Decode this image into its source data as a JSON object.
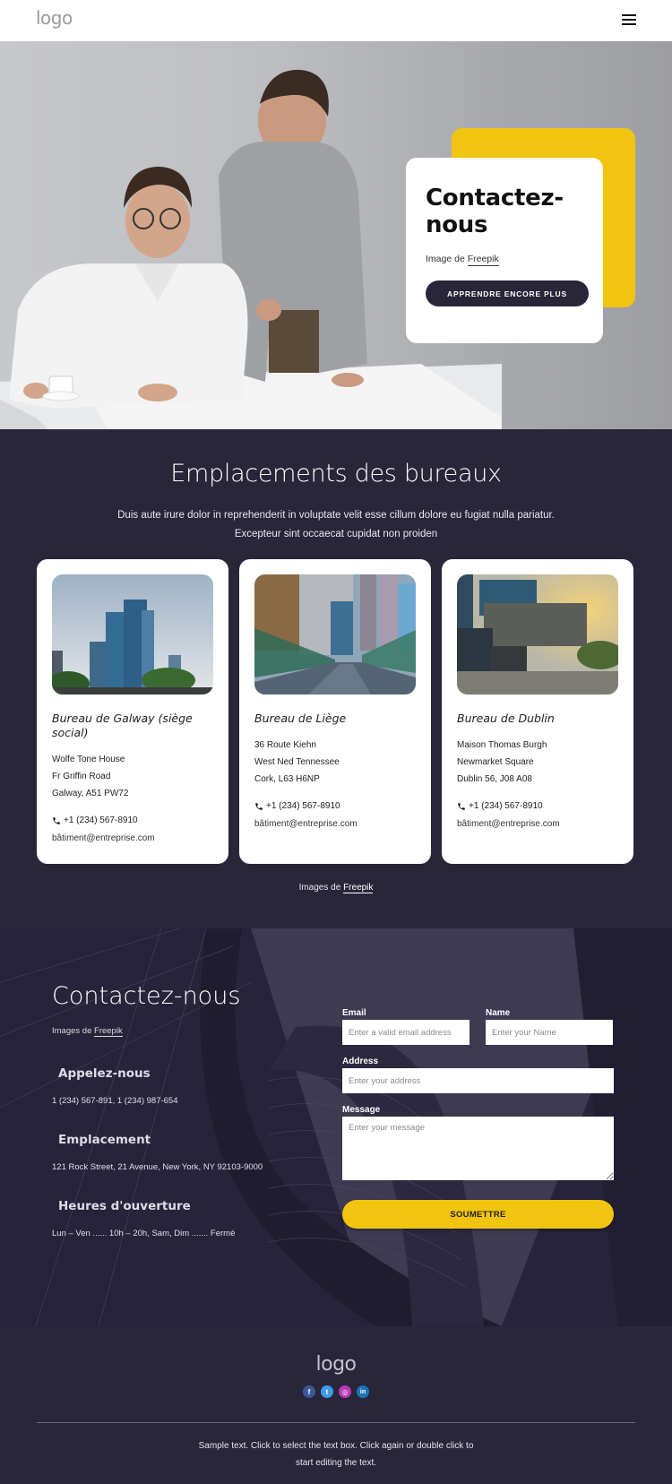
{
  "header": {
    "logo": "logo",
    "menu_icon": "hamburger-menu-icon"
  },
  "hero": {
    "title": "Contactez-nous",
    "credit_prefix": "Image de",
    "credit_link": "Freepik",
    "button_label": "APPRENDRE ENCORE PLUS",
    "accent_color": "#f1c40f",
    "button_color": "#292639"
  },
  "offices": {
    "title": "Emplacements des bureaux",
    "lead_line1": "Duis aute irure dolor in reprehenderit in voluptate velit esse cillum dolore eu fugiat nulla pariatur.",
    "lead_line2": "Excepteur sint occaecat cupidat non proiden",
    "cards": [
      {
        "name": "Bureau de Galway (siège social)",
        "address": [
          "Wolfe Tone House",
          "Fr Griffin Road",
          "Galway, A51 PW72"
        ],
        "phone": "+1 (234) 567-8910",
        "email": "bâtiment@entreprise.com"
      },
      {
        "name": "Bureau de Liège",
        "address": [
          "36 Route Kiehn",
          "West Ned Tennessee",
          "Cork, L63 H6NP"
        ],
        "phone": "+1 (234) 567-8910",
        "email": "bâtiment@entreprise.com"
      },
      {
        "name": "Bureau de Dublin",
        "address": [
          "Maison Thomas Burgh",
          "Newmarket Square",
          "Dublin 56, J08 A08"
        ],
        "phone": "+1 (234) 567-8910",
        "email": "bâtiment@entreprise.com"
      }
    ],
    "credit_prefix": "Images de",
    "credit_link": "Freepik"
  },
  "contact": {
    "title": "Contactez-nous",
    "credit_prefix": "Images de",
    "credit_link": "Freepik",
    "call_heading": "Appelez-nous",
    "call_text": "1 (234) 567-891, 1 (234) 987-654",
    "location_heading": "Emplacement",
    "location_text": "121 Rock Street, 21 Avenue, New York, NY 92103-9000",
    "hours_heading": "Heures d'ouverture",
    "hours_text": "Lun – Ven ...... 10h – 20h, Sam, Dim ....... Fermé",
    "form": {
      "email_label": "Email",
      "email_placeholder": "Enter a valid email address",
      "name_label": "Name",
      "name_placeholder": "Enter your Name",
      "address_label": "Address",
      "address_placeholder": "Enter your address",
      "message_label": "Message",
      "message_placeholder": "Enter your message",
      "submit_label": "SOUMETTRE"
    }
  },
  "footer": {
    "logo": "logo",
    "social": [
      {
        "name": "facebook",
        "glyph": "f",
        "color": "#3b5998"
      },
      {
        "name": "twitter",
        "glyph": "t",
        "color": "#3d9be9"
      },
      {
        "name": "instagram",
        "glyph": "◎",
        "color": "#b83ab5"
      },
      {
        "name": "linkedin",
        "glyph": "in",
        "color": "#1a75b8"
      }
    ],
    "sample_line1": "Sample text. Click to select the text box. Click again or double click to",
    "sample_line2": "start editing the text."
  }
}
